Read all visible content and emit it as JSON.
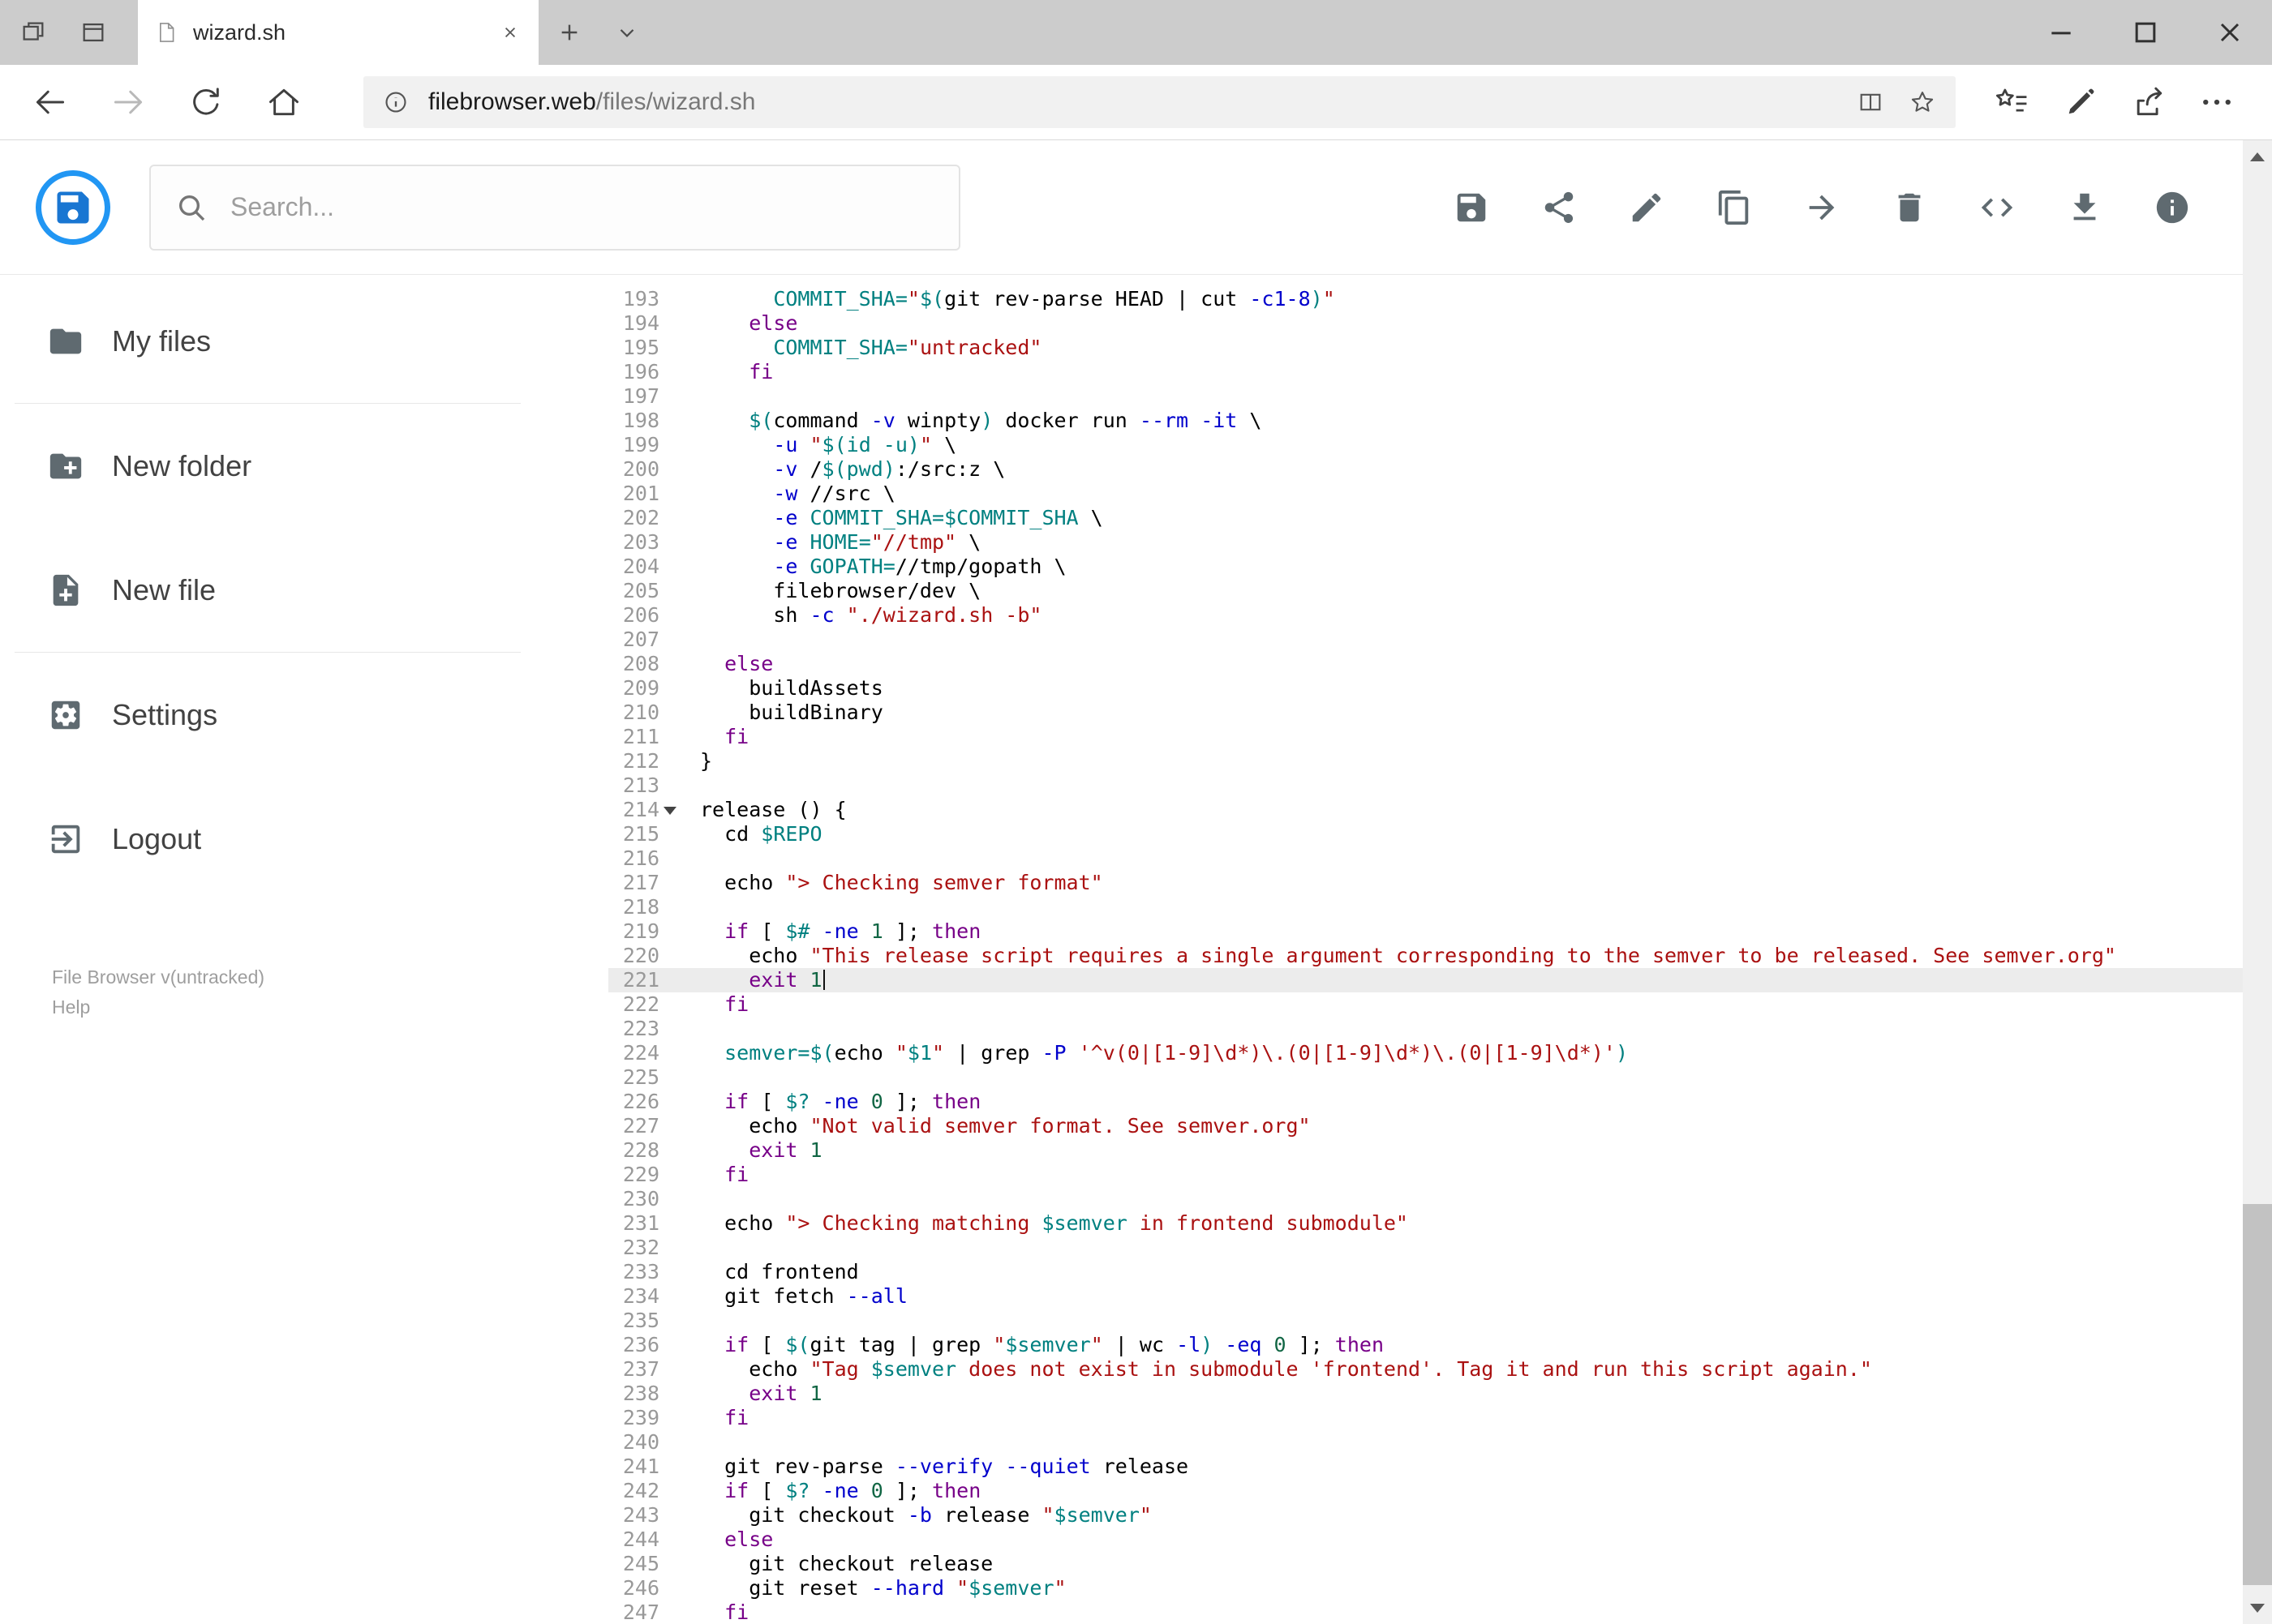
{
  "window": {
    "tab_title": "wizard.sh"
  },
  "browser": {
    "url_domain": "filebrowser.web",
    "url_path": "/files/wizard.sh"
  },
  "header": {
    "search_placeholder": "Search..."
  },
  "toolbar": {
    "icons": [
      "save",
      "share",
      "edit",
      "copy",
      "move",
      "delete",
      "code",
      "download",
      "info"
    ]
  },
  "sidebar": {
    "items": [
      {
        "label": "My files"
      },
      {
        "label": "New folder"
      },
      {
        "label": "New file"
      },
      {
        "label": "Settings"
      },
      {
        "label": "Logout"
      }
    ],
    "footer_version": "File Browser v(untracked)",
    "footer_help": "Help"
  },
  "colors": {
    "accent": "#2196f3",
    "k": "#770088",
    "s": "#aa1111",
    "v": "#008080",
    "n": "#116644",
    "a": "#0000cc"
  },
  "editor": {
    "first_line": 193,
    "last_line": 247,
    "active_line": 221,
    "fold_line": 214,
    "lines": [
      {
        "n": 193,
        "seg": [
          [
            "p",
            "      "
          ],
          [
            "v",
            "COMMIT_SHA="
          ],
          [
            "s",
            "\""
          ],
          [
            "v",
            "$("
          ],
          [
            "p",
            "git rev-parse HEAD | cut "
          ],
          [
            "a",
            "-c1-8"
          ],
          [
            "v",
            ")"
          ],
          [
            "s",
            "\""
          ]
        ]
      },
      {
        "n": 194,
        "seg": [
          [
            "p",
            "    "
          ],
          [
            "k",
            "else"
          ]
        ]
      },
      {
        "n": 195,
        "seg": [
          [
            "p",
            "      "
          ],
          [
            "v",
            "COMMIT_SHA="
          ],
          [
            "s",
            "\"untracked\""
          ]
        ]
      },
      {
        "n": 196,
        "seg": [
          [
            "p",
            "    "
          ],
          [
            "k",
            "fi"
          ]
        ]
      },
      {
        "n": 197,
        "seg": []
      },
      {
        "n": 198,
        "seg": [
          [
            "p",
            "    "
          ],
          [
            "v",
            "$("
          ],
          [
            "p",
            "command "
          ],
          [
            "a",
            "-v"
          ],
          [
            "p",
            " winpty"
          ],
          [
            "v",
            ")"
          ],
          [
            "p",
            " docker run "
          ],
          [
            "a",
            "--rm"
          ],
          [
            "p",
            " "
          ],
          [
            "a",
            "-it"
          ],
          [
            "p",
            " \\"
          ]
        ]
      },
      {
        "n": 199,
        "seg": [
          [
            "p",
            "      "
          ],
          [
            "a",
            "-u"
          ],
          [
            "p",
            " "
          ],
          [
            "s",
            "\""
          ],
          [
            "v",
            "$(id -u)"
          ],
          [
            "s",
            "\""
          ],
          [
            "p",
            " \\"
          ]
        ]
      },
      {
        "n": 200,
        "seg": [
          [
            "p",
            "      "
          ],
          [
            "a",
            "-v"
          ],
          [
            "p",
            " /"
          ],
          [
            "v",
            "$(pwd)"
          ],
          [
            "p",
            ":/src:z \\"
          ]
        ]
      },
      {
        "n": 201,
        "seg": [
          [
            "p",
            "      "
          ],
          [
            "a",
            "-w"
          ],
          [
            "p",
            " //src \\"
          ]
        ]
      },
      {
        "n": 202,
        "seg": [
          [
            "p",
            "      "
          ],
          [
            "a",
            "-e"
          ],
          [
            "p",
            " "
          ],
          [
            "v",
            "COMMIT_SHA=$COMMIT_SHA"
          ],
          [
            "p",
            " \\"
          ]
        ]
      },
      {
        "n": 203,
        "seg": [
          [
            "p",
            "      "
          ],
          [
            "a",
            "-e"
          ],
          [
            "p",
            " "
          ],
          [
            "v",
            "HOME="
          ],
          [
            "s",
            "\"//tmp\""
          ],
          [
            "p",
            " \\"
          ]
        ]
      },
      {
        "n": 204,
        "seg": [
          [
            "p",
            "      "
          ],
          [
            "a",
            "-e"
          ],
          [
            "p",
            " "
          ],
          [
            "v",
            "GOPATH="
          ],
          [
            "p",
            "//tmp/gopath \\"
          ]
        ]
      },
      {
        "n": 205,
        "seg": [
          [
            "p",
            "      filebrowser/dev \\"
          ]
        ]
      },
      {
        "n": 206,
        "seg": [
          [
            "p",
            "      sh "
          ],
          [
            "a",
            "-c"
          ],
          [
            "p",
            " "
          ],
          [
            "s",
            "\"./wizard.sh -b\""
          ]
        ]
      },
      {
        "n": 207,
        "seg": []
      },
      {
        "n": 208,
        "seg": [
          [
            "p",
            "  "
          ],
          [
            "k",
            "else"
          ]
        ]
      },
      {
        "n": 209,
        "seg": [
          [
            "p",
            "    buildAssets"
          ]
        ]
      },
      {
        "n": 210,
        "seg": [
          [
            "p",
            "    buildBinary"
          ]
        ]
      },
      {
        "n": 211,
        "seg": [
          [
            "p",
            "  "
          ],
          [
            "k",
            "fi"
          ]
        ]
      },
      {
        "n": 212,
        "seg": [
          [
            "p",
            "}"
          ]
        ]
      },
      {
        "n": 213,
        "seg": []
      },
      {
        "n": 214,
        "seg": [
          [
            "p",
            "release () {"
          ]
        ]
      },
      {
        "n": 215,
        "seg": [
          [
            "p",
            "  cd "
          ],
          [
            "v",
            "$REPO"
          ]
        ]
      },
      {
        "n": 216,
        "seg": []
      },
      {
        "n": 217,
        "seg": [
          [
            "p",
            "  echo "
          ],
          [
            "s",
            "\"> Checking semver format\""
          ]
        ]
      },
      {
        "n": 218,
        "seg": []
      },
      {
        "n": 219,
        "seg": [
          [
            "p",
            "  "
          ],
          [
            "k",
            "if"
          ],
          [
            "p",
            " [ "
          ],
          [
            "v",
            "$#"
          ],
          [
            "p",
            " "
          ],
          [
            "a",
            "-ne"
          ],
          [
            "p",
            " "
          ],
          [
            "n",
            "1"
          ],
          [
            "p",
            " ]; "
          ],
          [
            "k",
            "then"
          ]
        ]
      },
      {
        "n": 220,
        "seg": [
          [
            "p",
            "    echo "
          ],
          [
            "s",
            "\"This release script requires a single argument corresponding to the semver to be released. See semver.org\""
          ]
        ]
      },
      {
        "n": 221,
        "seg": [
          [
            "p",
            "    "
          ],
          [
            "k",
            "exit"
          ],
          [
            "p",
            " "
          ],
          [
            "n",
            "1"
          ]
        ]
      },
      {
        "n": 222,
        "seg": [
          [
            "p",
            "  "
          ],
          [
            "k",
            "fi"
          ]
        ]
      },
      {
        "n": 223,
        "seg": []
      },
      {
        "n": 224,
        "seg": [
          [
            "p",
            "  "
          ],
          [
            "v",
            "semver=$("
          ],
          [
            "p",
            "echo "
          ],
          [
            "s",
            "\""
          ],
          [
            "v",
            "$1"
          ],
          [
            "s",
            "\""
          ],
          [
            "p",
            " | grep "
          ],
          [
            "a",
            "-P"
          ],
          [
            "p",
            " "
          ],
          [
            "s",
            "'^v(0|[1-9]\\d*)\\.(0|[1-9]\\d*)\\.(0|[1-9]\\d*)'"
          ],
          [
            "v",
            ")"
          ]
        ]
      },
      {
        "n": 225,
        "seg": []
      },
      {
        "n": 226,
        "seg": [
          [
            "p",
            "  "
          ],
          [
            "k",
            "if"
          ],
          [
            "p",
            " [ "
          ],
          [
            "v",
            "$?"
          ],
          [
            "p",
            " "
          ],
          [
            "a",
            "-ne"
          ],
          [
            "p",
            " "
          ],
          [
            "n",
            "0"
          ],
          [
            "p",
            " ]; "
          ],
          [
            "k",
            "then"
          ]
        ]
      },
      {
        "n": 227,
        "seg": [
          [
            "p",
            "    echo "
          ],
          [
            "s",
            "\"Not valid semver format. See semver.org\""
          ]
        ]
      },
      {
        "n": 228,
        "seg": [
          [
            "p",
            "    "
          ],
          [
            "k",
            "exit"
          ],
          [
            "p",
            " "
          ],
          [
            "n",
            "1"
          ]
        ]
      },
      {
        "n": 229,
        "seg": [
          [
            "p",
            "  "
          ],
          [
            "k",
            "fi"
          ]
        ]
      },
      {
        "n": 230,
        "seg": []
      },
      {
        "n": 231,
        "seg": [
          [
            "p",
            "  echo "
          ],
          [
            "s",
            "\"> Checking matching "
          ],
          [
            "v",
            "$semver"
          ],
          [
            "s",
            " in frontend submodule\""
          ]
        ]
      },
      {
        "n": 232,
        "seg": []
      },
      {
        "n": 233,
        "seg": [
          [
            "p",
            "  cd frontend"
          ]
        ]
      },
      {
        "n": 234,
        "seg": [
          [
            "p",
            "  git fetch "
          ],
          [
            "a",
            "--all"
          ]
        ]
      },
      {
        "n": 235,
        "seg": []
      },
      {
        "n": 236,
        "seg": [
          [
            "p",
            "  "
          ],
          [
            "k",
            "if"
          ],
          [
            "p",
            " [ "
          ],
          [
            "v",
            "$("
          ],
          [
            "p",
            "git tag | grep "
          ],
          [
            "s",
            "\""
          ],
          [
            "v",
            "$semver"
          ],
          [
            "s",
            "\""
          ],
          [
            "p",
            " | wc "
          ],
          [
            "a",
            "-l"
          ],
          [
            "v",
            ")"
          ],
          [
            "p",
            " "
          ],
          [
            "a",
            "-eq"
          ],
          [
            "p",
            " "
          ],
          [
            "n",
            "0"
          ],
          [
            "p",
            " ]; "
          ],
          [
            "k",
            "then"
          ]
        ]
      },
      {
        "n": 237,
        "seg": [
          [
            "p",
            "    echo "
          ],
          [
            "s",
            "\"Tag "
          ],
          [
            "v",
            "$semver"
          ],
          [
            "s",
            " does not exist in submodule 'frontend'. Tag it and run this script again.\""
          ]
        ]
      },
      {
        "n": 238,
        "seg": [
          [
            "p",
            "    "
          ],
          [
            "k",
            "exit"
          ],
          [
            "p",
            " "
          ],
          [
            "n",
            "1"
          ]
        ]
      },
      {
        "n": 239,
        "seg": [
          [
            "p",
            "  "
          ],
          [
            "k",
            "fi"
          ]
        ]
      },
      {
        "n": 240,
        "seg": []
      },
      {
        "n": 241,
        "seg": [
          [
            "p",
            "  git rev-parse "
          ],
          [
            "a",
            "--verify"
          ],
          [
            "p",
            " "
          ],
          [
            "a",
            "--quiet"
          ],
          [
            "p",
            " release"
          ]
        ]
      },
      {
        "n": 242,
        "seg": [
          [
            "p",
            "  "
          ],
          [
            "k",
            "if"
          ],
          [
            "p",
            " [ "
          ],
          [
            "v",
            "$?"
          ],
          [
            "p",
            " "
          ],
          [
            "a",
            "-ne"
          ],
          [
            "p",
            " "
          ],
          [
            "n",
            "0"
          ],
          [
            "p",
            " ]; "
          ],
          [
            "k",
            "then"
          ]
        ]
      },
      {
        "n": 243,
        "seg": [
          [
            "p",
            "    git checkout "
          ],
          [
            "a",
            "-b"
          ],
          [
            "p",
            " release "
          ],
          [
            "s",
            "\""
          ],
          [
            "v",
            "$semver"
          ],
          [
            "s",
            "\""
          ]
        ]
      },
      {
        "n": 244,
        "seg": [
          [
            "p",
            "  "
          ],
          [
            "k",
            "else"
          ]
        ]
      },
      {
        "n": 245,
        "seg": [
          [
            "p",
            "    git checkout release"
          ]
        ]
      },
      {
        "n": 246,
        "seg": [
          [
            "p",
            "    git reset "
          ],
          [
            "a",
            "--hard"
          ],
          [
            "p",
            " "
          ],
          [
            "s",
            "\""
          ],
          [
            "v",
            "$semver"
          ],
          [
            "s",
            "\""
          ]
        ]
      },
      {
        "n": 247,
        "seg": [
          [
            "p",
            "  "
          ],
          [
            "k",
            "fi"
          ]
        ]
      }
    ]
  }
}
